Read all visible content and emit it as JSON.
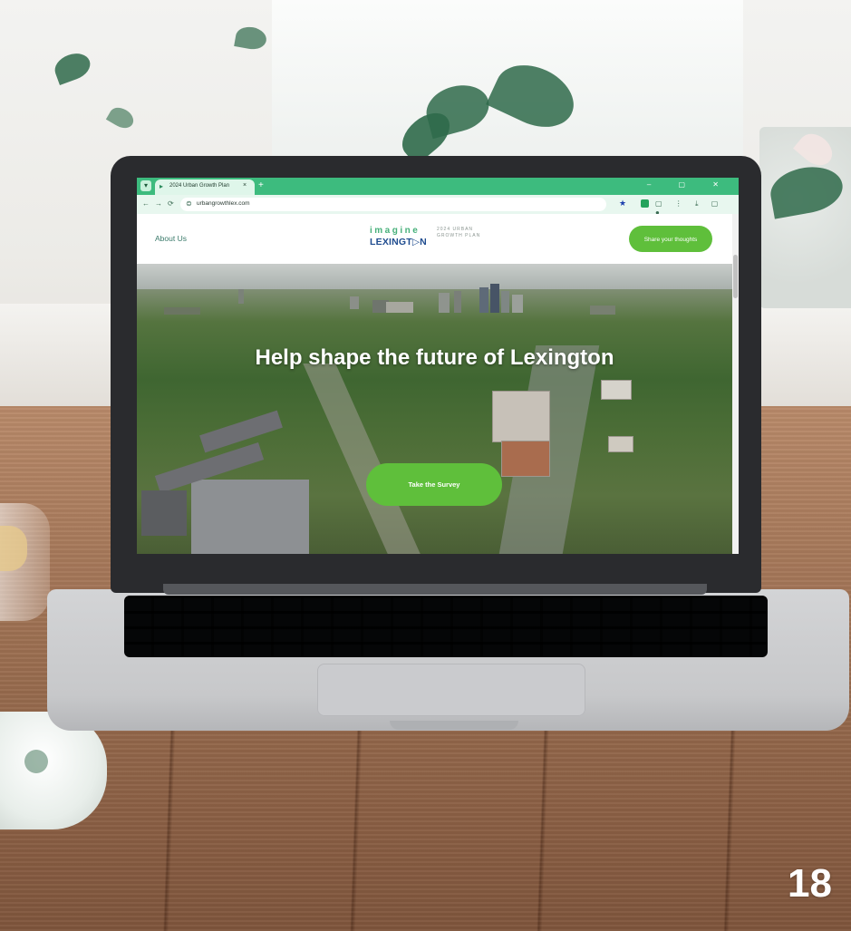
{
  "browser": {
    "tab_title": "2024 Urban Growth Plan",
    "tab_close": "×",
    "new_tab": "+",
    "url": "urbangrowthlex.com",
    "window_controls": "– ▢ ✕",
    "accent_color": "#3dbb7e"
  },
  "icons": {
    "tab_menu": "▾",
    "favicon": "▸",
    "back": "←",
    "forward": "→",
    "reload": "⟳",
    "site_info": "⊜",
    "star": "★",
    "extensions": "▢ ⋮ ⤓ ▢ ●"
  },
  "site": {
    "nav_about": "About Us",
    "logo_imagine": "imagine",
    "logo_lexington": "LEXINGT▷N",
    "logo_side": "2024 URBAN GROWTH PLAN",
    "share_button": "Share your thoughts",
    "hero_title": "Help shape the future of Lexington",
    "survey_button": "Take the Survey",
    "button_color": "#5fbf3b"
  },
  "photo": {
    "page_number": "18"
  }
}
